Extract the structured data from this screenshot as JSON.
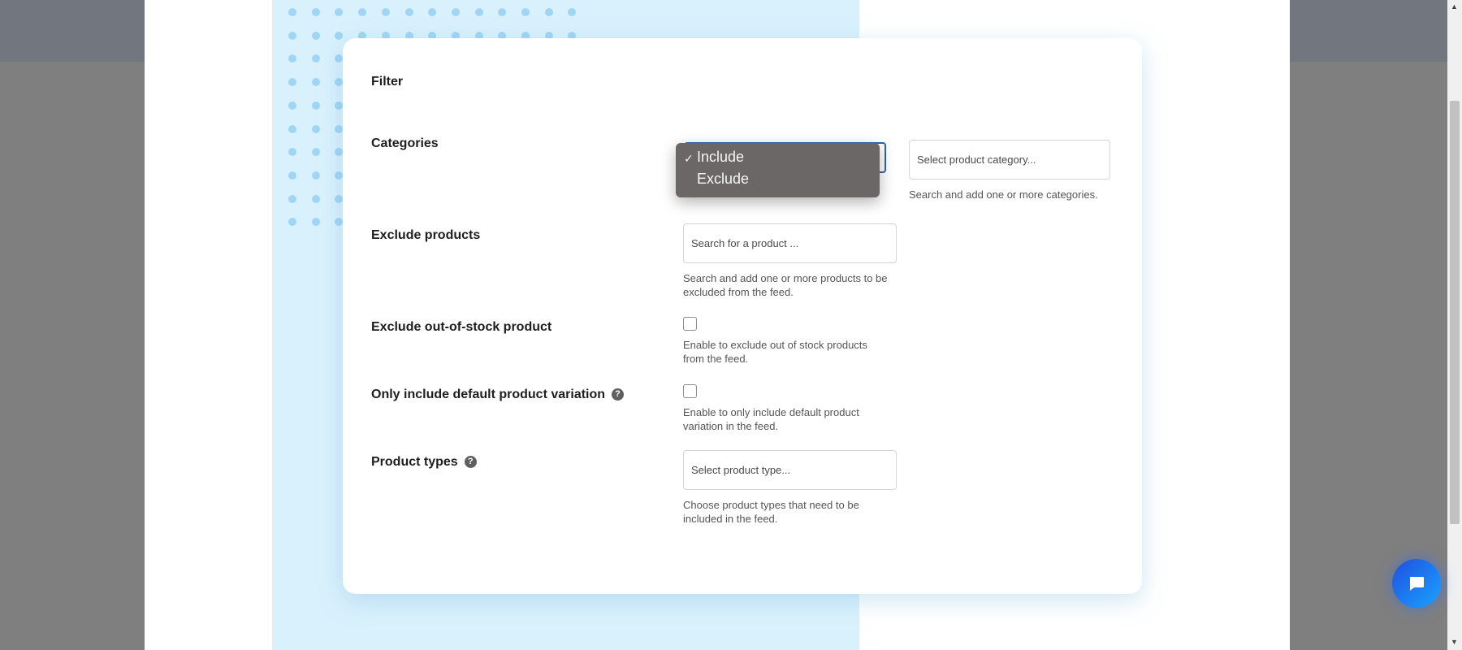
{
  "filter_section": {
    "title": "Filter",
    "fields": {
      "categories": {
        "label": "Categories",
        "mode_select": {
          "selected": "Include",
          "options": [
            "Include",
            "Exclude"
          ],
          "open": true
        },
        "category_input_placeholder": "Select product category...",
        "help": "Search and add one or more categories."
      },
      "exclude_products": {
        "label": "Exclude products",
        "input_placeholder": "Search for a product ...",
        "help_line1": "Search and add one or more products to be",
        "help_line2": "excluded from the feed."
      },
      "exclude_out_of_stock": {
        "label": "Exclude out-of-stock product",
        "checked": false,
        "help_line1": "Enable to exclude out of stock products",
        "help_line2": "from the feed."
      },
      "default_variation": {
        "label": "Only include default product variation",
        "checked": false,
        "help_line1": "Enable to only include default product",
        "help_line2": "variation in the feed."
      },
      "product_types": {
        "label": "Product types",
        "input_placeholder": "Select product type...",
        "help_line1": "Choose product types that need to be",
        "help_line2": "included in the feed."
      }
    }
  },
  "icons": {
    "help": "?",
    "check": "✓",
    "scroll_up": "▲",
    "scroll_down": "▼"
  },
  "colors": {
    "overlay": "#7f7f7f",
    "panel_blue": "#d9f1fd",
    "focus_blue": "#2c64b0",
    "chat_blue": "#1f6cf0"
  }
}
